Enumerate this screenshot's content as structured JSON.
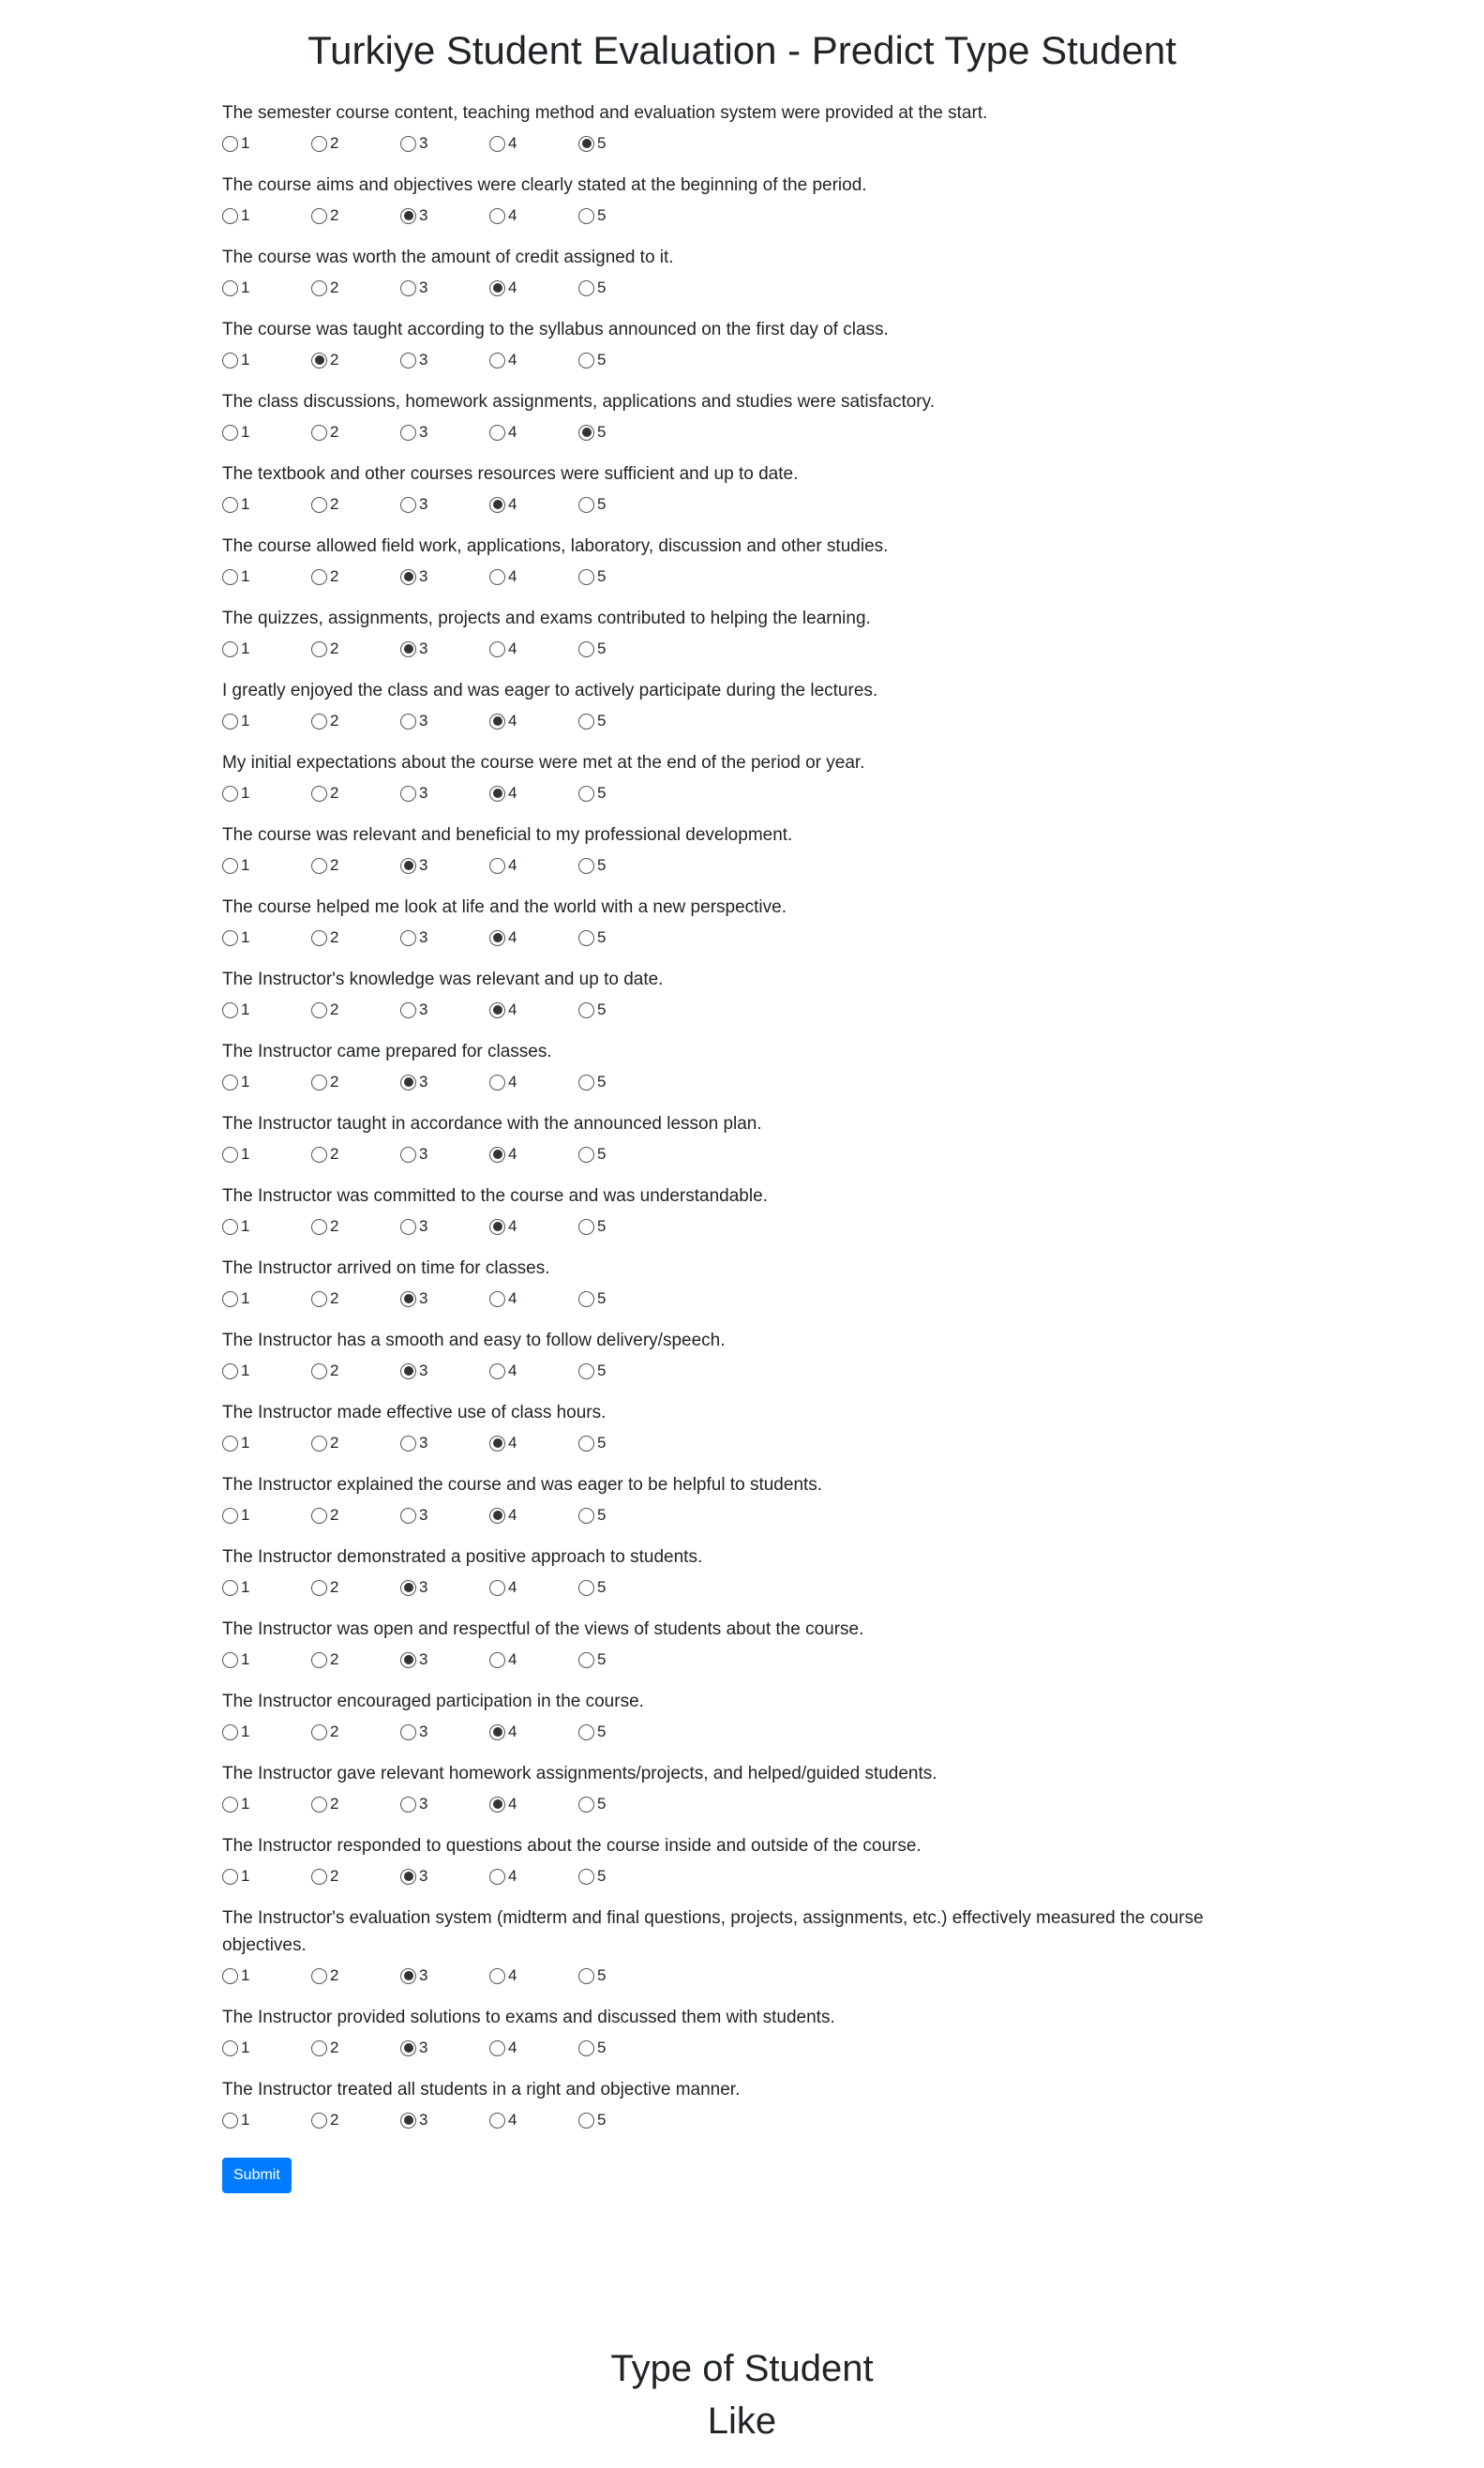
{
  "page_title": "Turkiye Student Evaluation - Predict Type Student",
  "options": [
    "1",
    "2",
    "3",
    "4",
    "5"
  ],
  "questions": [
    {
      "text": "The semester course content, teaching method and evaluation system were provided at the start.",
      "selected": "5"
    },
    {
      "text": "The course aims and objectives were clearly stated at the beginning of the period.",
      "selected": "3"
    },
    {
      "text": "The course was worth the amount of credit assigned to it.",
      "selected": "4"
    },
    {
      "text": "The course was taught according to the syllabus announced on the first day of class.",
      "selected": "2"
    },
    {
      "text": "The class discussions, homework assignments, applications and studies were satisfactory.",
      "selected": "5"
    },
    {
      "text": "The textbook and other courses resources were sufficient and up to date.",
      "selected": "4"
    },
    {
      "text": "The course allowed field work, applications, laboratory, discussion and other studies.",
      "selected": "3"
    },
    {
      "text": "The quizzes, assignments, projects and exams contributed to helping the learning.",
      "selected": "3"
    },
    {
      "text": "I greatly enjoyed the class and was eager to actively participate during the lectures.",
      "selected": "4"
    },
    {
      "text": "My initial expectations about the course were met at the end of the period or year.",
      "selected": "4"
    },
    {
      "text": "The course was relevant and beneficial to my professional development.",
      "selected": "3"
    },
    {
      "text": "The course helped me look at life and the world with a new perspective.",
      "selected": "4"
    },
    {
      "text": "The Instructor's knowledge was relevant and up to date.",
      "selected": "4"
    },
    {
      "text": "The Instructor came prepared for classes.",
      "selected": "3"
    },
    {
      "text": "The Instructor taught in accordance with the announced lesson plan.",
      "selected": "4"
    },
    {
      "text": "The Instructor was committed to the course and was understandable.",
      "selected": "4"
    },
    {
      "text": "The Instructor arrived on time for classes.",
      "selected": "3"
    },
    {
      "text": "The Instructor has a smooth and easy to follow delivery/speech.",
      "selected": "3"
    },
    {
      "text": "The Instructor made effective use of class hours.",
      "selected": "4"
    },
    {
      "text": "The Instructor explained the course and was eager to be helpful to students.",
      "selected": "4"
    },
    {
      "text": "The Instructor demonstrated a positive approach to students.",
      "selected": "3"
    },
    {
      "text": "The Instructor was open and respectful of the views of students about the course.",
      "selected": "3"
    },
    {
      "text": "The Instructor encouraged participation in the course.",
      "selected": "4"
    },
    {
      "text": "The Instructor gave relevant homework assignments/projects, and helped/guided students.",
      "selected": "4"
    },
    {
      "text": "The Instructor responded to questions about the course inside and outside of the course.",
      "selected": "3"
    },
    {
      "text": "The Instructor's evaluation system (midterm and final questions, projects, assignments, etc.) effectively measured the course objectives.",
      "selected": "3"
    },
    {
      "text": "The Instructor provided solutions to exams and discussed them with students.",
      "selected": "3"
    },
    {
      "text": "The Instructor treated all students in a right and objective manner.",
      "selected": "3"
    }
  ],
  "submit_label": "Submit",
  "result": {
    "heading": "Type of Student",
    "value": "Like"
  },
  "colors": {
    "primary_button": "#007bff",
    "text": "#212529"
  }
}
